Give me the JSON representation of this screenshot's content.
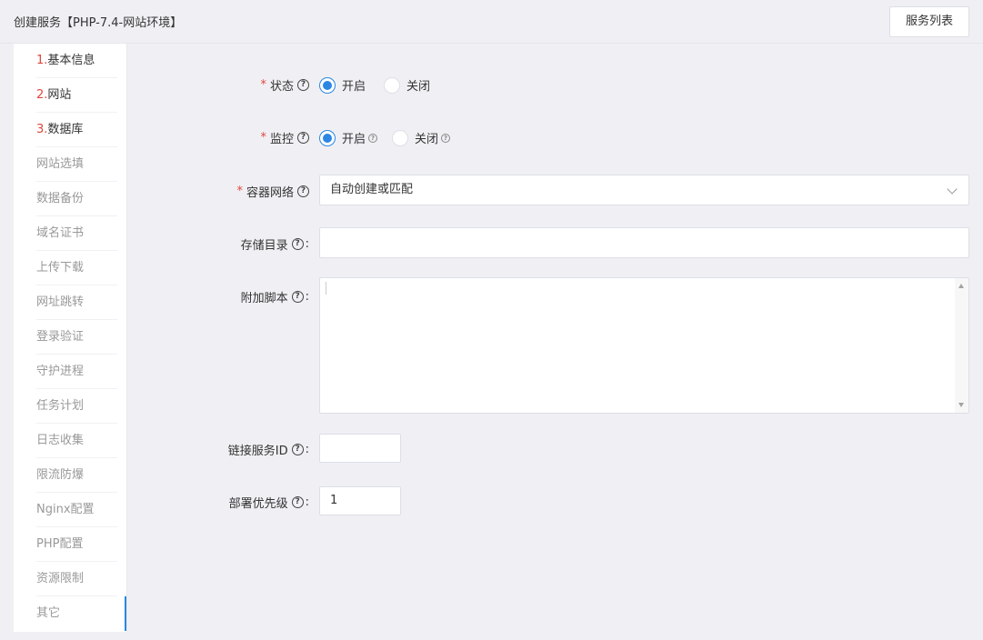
{
  "header": {
    "title": "创建服务【PHP-7.4-网站环境】",
    "service_list_button": "服务列表"
  },
  "sidebar": {
    "items": [
      {
        "num": "1.",
        "label": "基本信息"
      },
      {
        "num": "2.",
        "label": "网站"
      },
      {
        "num": "3.",
        "label": "数据库"
      },
      {
        "num": "",
        "label": "网站选填"
      },
      {
        "num": "",
        "label": "数据备份"
      },
      {
        "num": "",
        "label": "域名证书"
      },
      {
        "num": "",
        "label": "上传下载"
      },
      {
        "num": "",
        "label": "网址跳转"
      },
      {
        "num": "",
        "label": "登录验证"
      },
      {
        "num": "",
        "label": "守护进程"
      },
      {
        "num": "",
        "label": "任务计划"
      },
      {
        "num": "",
        "label": "日志收集"
      },
      {
        "num": "",
        "label": "限流防爆"
      },
      {
        "num": "",
        "label": "Nginx配置"
      },
      {
        "num": "",
        "label": "PHP配置"
      },
      {
        "num": "",
        "label": "资源限制"
      },
      {
        "num": "",
        "label": "其它"
      }
    ]
  },
  "form": {
    "status": {
      "required": "*",
      "label": "状态",
      "options": [
        "开启",
        "关闭"
      ],
      "selected": "开启"
    },
    "monitor": {
      "required": "*",
      "label": "监控",
      "options": [
        "开启",
        "关闭"
      ],
      "selected": "开启"
    },
    "container_network": {
      "required": "*",
      "label": "容器网络",
      "value": "自动创建或匹配"
    },
    "storage_dir": {
      "label": "存储目录",
      "colon": ":",
      "value": ""
    },
    "extra_script": {
      "label": "附加脚本",
      "colon": ":",
      "value": ""
    },
    "link_service_id": {
      "label": "链接服务ID",
      "colon": ":",
      "value": ""
    },
    "deploy_priority": {
      "label": "部署优先级",
      "colon": ":",
      "value": "1"
    }
  },
  "icons": {
    "help": "question-circle-icon",
    "dropdown": "chevron-down-icon"
  },
  "colors": {
    "accent": "#2b87e3",
    "required": "#e0463e",
    "background": "#f0f0f4"
  }
}
